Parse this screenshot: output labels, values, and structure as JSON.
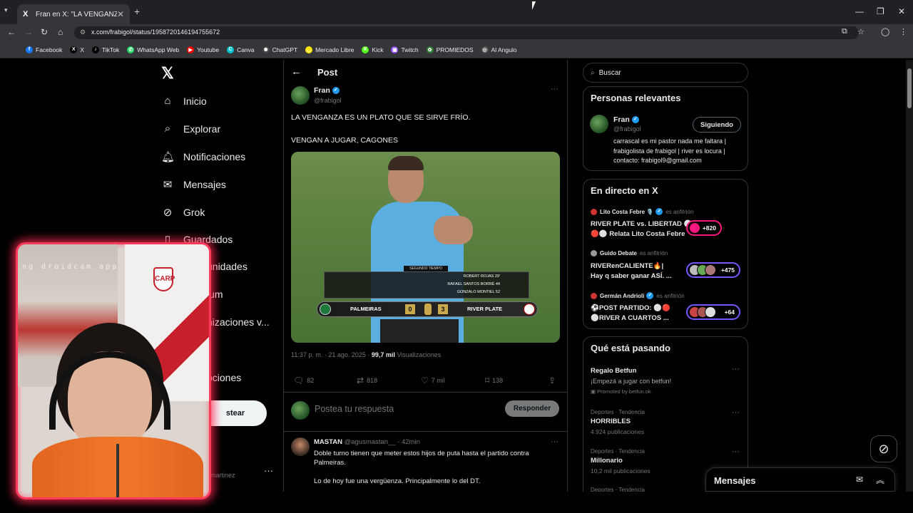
{
  "browser": {
    "tab_title": "Fran en X: \"LA VENGANZA ES U",
    "url": "x.com/frabigol/status/1958720146194755672",
    "bookmarks": [
      {
        "label": "Facebook",
        "color": "#1877f2",
        "icon": "f"
      },
      {
        "label": "X",
        "color": "#000000",
        "icon": "X"
      },
      {
        "label": "TikTok",
        "color": "#000000",
        "icon": "♪"
      },
      {
        "label": "WhatsApp Web",
        "color": "#25d366",
        "icon": "✆"
      },
      {
        "label": "Youtube",
        "color": "#ff0000",
        "icon": "▶"
      },
      {
        "label": "Canva",
        "color": "#00c4cc",
        "icon": "C"
      },
      {
        "label": "ChatGPT",
        "color": "#444444",
        "icon": "✺"
      },
      {
        "label": "Mercado Libre",
        "color": "#ffe600",
        "icon": "◡"
      },
      {
        "label": "Kick",
        "color": "#53fc18",
        "icon": "K"
      },
      {
        "label": "Twitch",
        "color": "#9146ff",
        "icon": "▣"
      },
      {
        "label": "PROMIEDOS",
        "color": "#2e7d32",
        "icon": "✿"
      },
      {
        "label": "Al Angulo",
        "color": "#555555",
        "icon": "◎"
      }
    ]
  },
  "nav": {
    "items": [
      {
        "label": "Inicio",
        "icon": "home-icon"
      },
      {
        "label": "Explorar",
        "icon": "search-icon"
      },
      {
        "label": "Notificaciones",
        "icon": "bell-icon"
      },
      {
        "label": "Mensajes",
        "icon": "mail-icon"
      },
      {
        "label": "Grok",
        "icon": "grok-icon"
      },
      {
        "label": "Guardados",
        "icon": "bookmark-icon"
      }
    ],
    "partial": {
      "comunidades": "unidades",
      "premium": "ium",
      "monetizaciones": "nizaciones v...",
      "opciones": "pciones"
    },
    "post_button": "stear",
    "account": "_martinez"
  },
  "post": {
    "header": "Post",
    "author_name": "Fran",
    "author_handle": "@frabigol",
    "text1": "LA VENGANZA ES UN PLATO QUE SE SIRVE FRÍO.",
    "text2": "VENGAN A JUGAR, CAGONES",
    "media": {
      "segment": "SEGUNDO TIEMPO",
      "scorers": [
        "ROBERT ROJAS 29'",
        "RAFAEL SANTOS BORRÉ 44",
        "GONZALO MONTIEL 52"
      ],
      "team1": "PALMEIRAS",
      "score1": "0",
      "score2": "3",
      "team2": "RIVER PLATE"
    },
    "time": "11:37 p. m. · 21 ago. 2025 · ",
    "views_count": "99,7 mil",
    "views_label": " Visualizaciones",
    "replies": "82",
    "reposts": "818",
    "likes": "7 mil",
    "bookmarks": "138",
    "reply_placeholder": "Postea tu respuesta",
    "reply_button": "Responder"
  },
  "comment": {
    "name": "MASTAN",
    "handle": " @agusmastan__ · 42min",
    "text1": "Doble turno tienen que meter estos hijos de puta hasta el partido contra Palmeiras.",
    "text2": "Lo de hoy fue una vergüenza. Principalmente lo del DT."
  },
  "sidebar": {
    "search_placeholder": "Buscar",
    "relevant": {
      "title": "Personas relevantes",
      "name": "Fran",
      "handle": "@frabigol",
      "follow": "Siguiendo",
      "bio": "carrascal es mi pastor nada me faltara | frabigolista de frabigol | river es locura | contacto: frabigol9@gmail.com"
    },
    "live": {
      "title": "En directo en X",
      "items": [
        {
          "host": "Lito Costa Febre 🎙️",
          "role": "es anfitrión",
          "title1": "RIVER PLATE vs. LIBERTAD ⚪",
          "title2": "🔴⚪ Relata Lito Costa Febre",
          "count": "+820"
        },
        {
          "host": "Guido Debate",
          "role": "es anfitrión",
          "title1": "RIVERenCALIENTE🔥|",
          "title2": "Hay q saber ganar ASÍ. ...",
          "count": "+475"
        },
        {
          "host": "Germán Andrioli",
          "role": "es anfitrión",
          "title1": "⚽POST PARTIDO: ⚪🔴",
          "title2": "⚪RIVER A CUARTOS ...",
          "count": "+64"
        }
      ]
    },
    "trends": {
      "title": "Qué está pasando",
      "items": [
        {
          "category": "",
          "name": "Regalo Betfun",
          "detail": "¡Empezá a jugar con betfun!",
          "promo": "Promoted by betfun.ok"
        },
        {
          "category": "Deportes · Tendencia",
          "name": "HORRIBLES",
          "detail": "4.924 publicaciones"
        },
        {
          "category": "Deportes · Tendencia",
          "name": "Millonario",
          "detail": "10,2 mil publicaciones"
        },
        {
          "category": "Deportes · Tendencia",
          "name": "",
          "detail": ""
        }
      ]
    },
    "messages": "Mensajes"
  },
  "webcam": {
    "watermark": "ng droidcam.app",
    "crest": "CARP"
  },
  "colors": {
    "accent": "#1d9bf0",
    "live_pill": "#7856ff",
    "cam_border": "#ff3b5c"
  }
}
